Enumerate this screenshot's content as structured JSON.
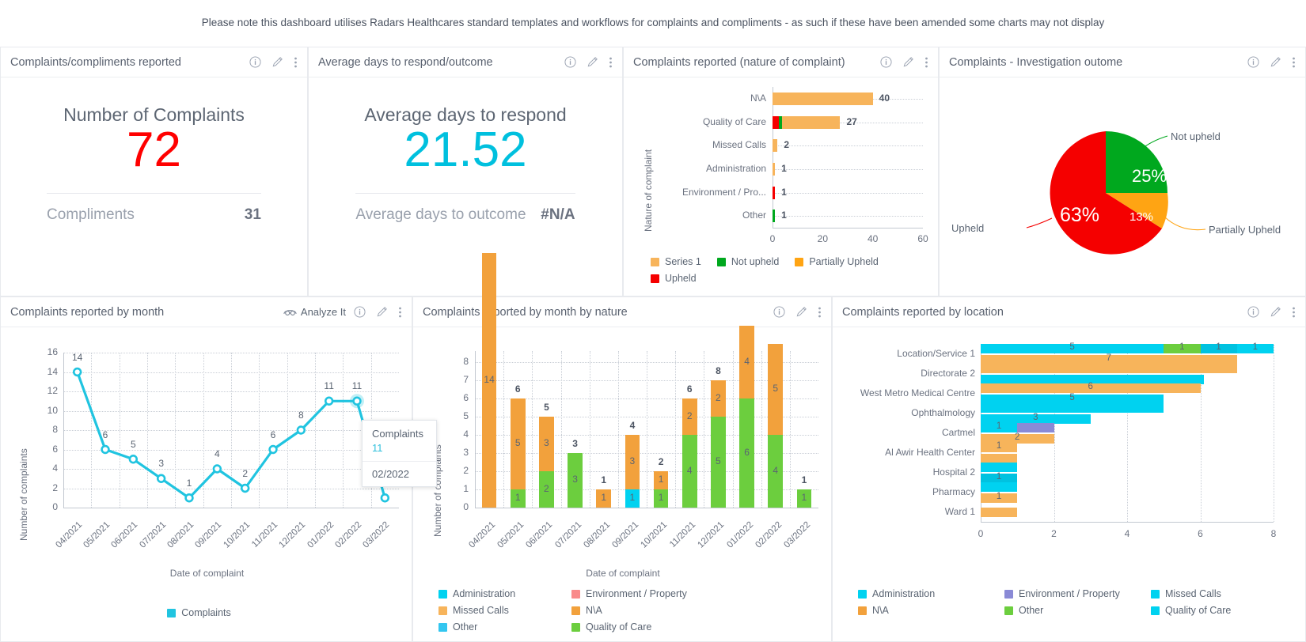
{
  "banner": {
    "note": "Please note this dashboard utilises Radars Healthcares standard templates and workflows for complaints and compliments - as such if these have been amended some charts may not display"
  },
  "icons": {
    "info": "info-icon",
    "edit": "pencil-icon",
    "more": "kebab-menu-icon",
    "analyze": "analyze-it-icon"
  },
  "panels": {
    "complaints_reported": {
      "title": "Complaints/compliments reported",
      "kpi_label": "Number of Complaints",
      "kpi_value": "72",
      "kpi_color": "#ff0000",
      "sub_label": "Compliments",
      "sub_value": "31"
    },
    "avg_days": {
      "title": "Average days to respond/outcome",
      "kpi_label": "Average days to respond",
      "kpi_value": "21.52",
      "kpi_color": "#00c0de",
      "sub_label": "Average days to outcome",
      "sub_value": "#N/A"
    },
    "nature": {
      "title": "Complaints reported (nature of complaint)"
    },
    "investigation": {
      "title": "Complaints - Investigation outome"
    },
    "by_month": {
      "title": "Complaints reported by month",
      "analyze_label": "Analyze It"
    },
    "by_month_nature": {
      "title": "Complaints reported by month by nature"
    },
    "by_location": {
      "title": "Complaints reported by location"
    }
  },
  "tooltip": {
    "title": "Complaints",
    "value": "11",
    "date": "02/2022"
  },
  "chart_data": [
    {
      "id": "nature_of_complaint",
      "type": "bar",
      "orientation": "horizontal",
      "stacked": true,
      "title": "Complaints reported (nature of complaint)",
      "ylabel": "Nature of complaint",
      "xlabel": "",
      "xlim": [
        0,
        60
      ],
      "xticks": [
        0,
        20,
        40,
        60
      ],
      "grid": true,
      "categories": [
        "N\\A",
        "Quality of Care",
        "Missed Calls",
        "Administration",
        "Environment / Pro...",
        "Other"
      ],
      "totals": [
        "40",
        "27",
        "2",
        "1",
        "1",
        "1"
      ],
      "legend": [
        {
          "name": "Series 1",
          "color": "#f7b45b"
        },
        {
          "name": "Not upheld",
          "color": "#00a81e"
        },
        {
          "name": "Partially Upheld",
          "color": "#ffa413"
        },
        {
          "name": "Upheld",
          "color": "#f50000"
        }
      ],
      "series": [
        {
          "name": "Upheld",
          "color": "#f50000",
          "values": [
            0,
            2.6,
            0,
            0,
            1,
            0
          ]
        },
        {
          "name": "Not upheld",
          "color": "#00a81e",
          "values": [
            0,
            1.2,
            0,
            0,
            0,
            1
          ]
        },
        {
          "name": "Partially Upheld",
          "color": "#ffa413",
          "values": [
            0,
            0,
            0,
            0,
            0,
            0
          ]
        },
        {
          "name": "Series 1",
          "color": "#f7b45b",
          "values": [
            40,
            23.2,
            2,
            1,
            0,
            0
          ]
        }
      ]
    },
    {
      "id": "investigation_outcome",
      "type": "pie",
      "title": "Complaints - Investigation outome",
      "slices": [
        {
          "label": "Upheld",
          "pct": "63%",
          "value": 63,
          "color": "#f50000"
        },
        {
          "label": "Not upheld",
          "pct": "25%",
          "value": 25,
          "color": "#00a81e"
        },
        {
          "label": "Partially Upheld",
          "pct": "13%",
          "value": 13,
          "color": "#ffa413"
        }
      ]
    },
    {
      "id": "complaints_by_month",
      "type": "line",
      "title": "Complaints reported by month",
      "xlabel": "Date of complaint",
      "ylabel": "Number of complaints",
      "ylim": [
        0,
        16
      ],
      "yticks": [
        0,
        2,
        4,
        6,
        8,
        10,
        12,
        14,
        16
      ],
      "grid": true,
      "legend": [
        {
          "name": "Complaints",
          "color": "#20c4e0"
        }
      ],
      "categories": [
        "04/2021",
        "05/2021",
        "06/2021",
        "07/2021",
        "08/2021",
        "09/2021",
        "10/2021",
        "11/2021",
        "12/2021",
        "01/2022",
        "02/2022",
        "03/2022"
      ],
      "values": [
        14,
        6,
        5,
        3,
        1,
        4,
        2,
        6,
        8,
        11,
        11,
        1
      ]
    },
    {
      "id": "complaints_by_month_by_nature",
      "type": "bar",
      "stacked": true,
      "title": "Complaints reported by month by nature",
      "xlabel": "Date of complaint",
      "ylabel": "Number of complaints",
      "ylim": [
        0,
        8
      ],
      "yticks": [
        0,
        1,
        2,
        3,
        4,
        5,
        6,
        7,
        8
      ],
      "grid": true,
      "categories": [
        "04/2021",
        "05/2021",
        "06/2021",
        "07/2021",
        "08/2021",
        "09/2021",
        "10/2021",
        "11/2021",
        "12/2021",
        "01/2022",
        "02/2022",
        "03/2022"
      ],
      "totals": [
        "",
        "6",
        "5",
        "3",
        "1",
        "4",
        "2",
        "6",
        "8",
        "",
        "",
        "1"
      ],
      "legend": [
        {
          "name": "Administration",
          "color": "#00d2f0"
        },
        {
          "name": "Environment / Property",
          "color": "#f98a8a"
        },
        {
          "name": "Missed Calls",
          "color": "#f7b45b"
        },
        {
          "name": "N\\A",
          "color": "#f2a13c"
        },
        {
          "name": "Other",
          "color": "#33c6f0"
        },
        {
          "name": "Quality of Care",
          "color": "#6cce3e"
        }
      ],
      "series": [
        {
          "name": "Administration",
          "color": "#00d2f0",
          "values": [
            0,
            0,
            0,
            0,
            0,
            1,
            0,
            0,
            0,
            0,
            0,
            0
          ]
        },
        {
          "name": "Quality of Care",
          "color": "#6cce3e",
          "values": [
            0,
            1,
            2,
            3,
            0,
            0,
            1,
            4,
            5,
            6,
            4,
            1
          ]
        },
        {
          "name": "N\\A",
          "color": "#f2a13c",
          "values": [
            14,
            5,
            3,
            0,
            1,
            3,
            1,
            2,
            2,
            4,
            5,
            0
          ]
        }
      ],
      "bar_labels": [
        [
          "14"
        ],
        [
          "5",
          "1"
        ],
        [
          "3",
          "2"
        ],
        [
          "3"
        ],
        [
          "1"
        ],
        [
          "3",
          "1"
        ],
        [
          "1",
          "1"
        ],
        [
          "2",
          "4"
        ],
        [
          "1",
          "2",
          "5"
        ],
        [
          "4",
          "6"
        ],
        [
          "5",
          "4"
        ],
        [
          "1"
        ]
      ]
    },
    {
      "id": "complaints_by_location",
      "type": "bar",
      "orientation": "horizontal",
      "grouped": true,
      "title": "Complaints reported by location",
      "xlim": [
        0,
        8
      ],
      "xticks": [
        0,
        2,
        4,
        6,
        8
      ],
      "grid": true,
      "categories": [
        "Location/Service 1",
        "Directorate 2",
        "West Metro Medical Centre",
        "Ophthalmology",
        "Cartmel",
        "Al Awir Health Center",
        "Hospital 2",
        "Pharmacy",
        "Ward 1"
      ],
      "legend": [
        {
          "name": "Administration",
          "color": "#00d2f0"
        },
        {
          "name": "Environment / Property",
          "color": "#8a8ad6"
        },
        {
          "name": "Missed Calls",
          "color": "#00d2f0"
        },
        {
          "name": "N\\A",
          "color": "#f2a13c"
        },
        {
          "name": "Other",
          "color": "#6cce3e"
        },
        {
          "name": "Quality of Care",
          "color": "#00d2f0"
        }
      ],
      "rows": [
        {
          "label": "Location/Service 1",
          "bars": [
            {
              "segments": [
                {
                  "v": 5,
                  "color": "#00d2f0",
                  "label": "5"
                },
                {
                  "v": 1,
                  "color": "#6cce3e",
                  "label": "1"
                },
                {
                  "v": 1,
                  "color": "#00c2e0",
                  "label": "1"
                },
                {
                  "v": 1,
                  "color": "#00d2f0",
                  "label": "1"
                }
              ]
            },
            {
              "segments": [
                {
                  "v": 7,
                  "color": "#f7b45b",
                  "label": "7"
                }
              ]
            }
          ]
        },
        {
          "label": "Directorate 2",
          "bars": [
            {
              "segments": [
                {
                  "v": 7,
                  "color": "#f7b45b",
                  "label": ""
                }
              ]
            },
            {
              "segments": [
                {
                  "v": 6.1,
                  "color": "#00d2f0",
                  "label": ""
                }
              ]
            }
          ]
        },
        {
          "label": "West Metro Medical Centre",
          "bars": [
            {
              "segments": [
                {
                  "v": 6,
                  "color": "#f7b45b",
                  "label": "6"
                }
              ]
            },
            {
              "segments": [
                {
                  "v": 5,
                  "color": "#00d2f0",
                  "label": "5"
                }
              ]
            }
          ]
        },
        {
          "label": "Ophthalmology",
          "bars": [
            {
              "segments": [
                {
                  "v": 5,
                  "color": "#00d2f0",
                  "label": ""
                }
              ]
            },
            {
              "segments": [
                {
                  "v": 3,
                  "color": "#00d2f0",
                  "label": "3"
                }
              ]
            }
          ]
        },
        {
          "label": "Cartmel",
          "bars": [
            {
              "segments": [
                {
                  "v": 1,
                  "color": "#00d2f0",
                  "label": "1"
                },
                {
                  "v": 1,
                  "color": "#8a8ad6",
                  "label": ""
                }
              ]
            },
            {
              "segments": [
                {
                  "v": 2,
                  "color": "#f7b45b",
                  "label": "2"
                }
              ]
            }
          ]
        },
        {
          "label": "Al Awir Health Center",
          "bars": [
            {
              "segments": [
                {
                  "v": 1,
                  "color": "#f7b45b",
                  "label": "1"
                }
              ]
            },
            {
              "segments": [
                {
                  "v": 1,
                  "color": "#f7b45b",
                  "label": ""
                }
              ]
            }
          ]
        },
        {
          "label": "Hospital 2",
          "bars": [
            {
              "segments": [
                {
                  "v": 1,
                  "color": "#00d2f0",
                  "label": ""
                }
              ]
            },
            {
              "segments": [
                {
                  "v": 1,
                  "color": "#00c2e0",
                  "label": "1"
                }
              ]
            }
          ]
        },
        {
          "label": "Pharmacy",
          "bars": [
            {
              "segments": [
                {
                  "v": 1,
                  "color": "#00d2f0",
                  "label": ""
                }
              ]
            },
            {
              "segments": [
                {
                  "v": 1,
                  "color": "#f7b45b",
                  "label": "1"
                }
              ]
            }
          ]
        },
        {
          "label": "Ward 1",
          "bars": [
            {
              "segments": [
                {
                  "v": 1,
                  "color": "#f7b45b",
                  "label": ""
                }
              ]
            }
          ]
        }
      ]
    }
  ]
}
